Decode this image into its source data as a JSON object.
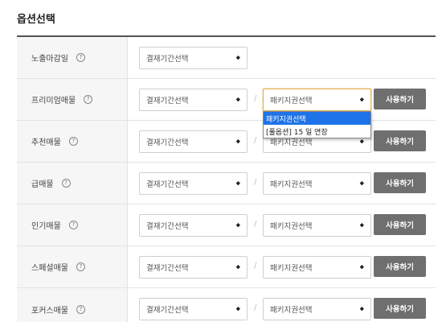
{
  "page": {
    "title": "옵션선택"
  },
  "common": {
    "period_select_value": "결재기간선택",
    "package_select_value": "패키지권선택",
    "use_button_label": "사용하기",
    "help_glyph": "?",
    "select_arrow": "◆",
    "separator": "/"
  },
  "rows": [
    {
      "label": "노출마감일"
    },
    {
      "label": "프리미엄매물"
    },
    {
      "label": "추천매물"
    },
    {
      "label": "급매물"
    },
    {
      "label": "인기매물"
    },
    {
      "label": "스페셜매물"
    },
    {
      "label": "포커스매물"
    }
  ],
  "dropdown": {
    "options": [
      "패키지권선택",
      "[풀옵션] 15 일 연장"
    ],
    "active_index": 0
  },
  "colors": {
    "accent_highlight": "#1e73e8",
    "button_bg": "#6f6f6f",
    "focus_border": "#e0b356"
  }
}
